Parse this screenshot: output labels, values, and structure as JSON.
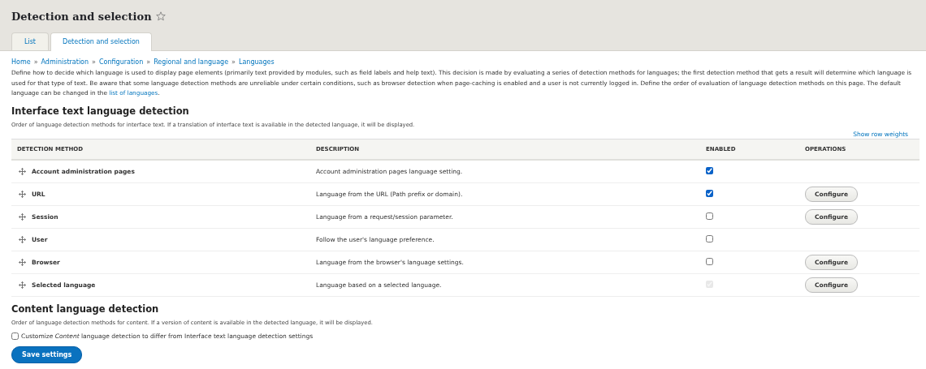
{
  "page_title": "Detection and selection",
  "favorite": {
    "starred": false
  },
  "tabs": [
    {
      "label": "List",
      "selected": false
    },
    {
      "label": "Detection and selection",
      "selected": true
    }
  ],
  "breadcrumb": [
    "Home",
    "Administration",
    "Configuration",
    "Regional and language",
    "Languages"
  ],
  "breadcrumb_separator": "»",
  "intro": {
    "text": "Define how to decide which language is used to display page elements (primarily text provided by modules, such as field labels and help text). This decision is made by evaluating a series of detection methods for languages; the first detection method that gets a result will determine which language is used for that type of text. Be aware that some language detection methods are unreliable under certain conditions, such as browser detection when page-caching is enabled and a user is not currently logged in. Define the order of evaluation of language detection methods on this page. The default language can be changed in the ",
    "link": "list of languages",
    "end": "."
  },
  "interface_section": {
    "heading": "Interface text language detection",
    "description": "Order of language detection methods for interface text. If a translation of interface text is available in the detected language, it will be displayed.",
    "row_weights_link": "Show row weights",
    "table": {
      "columns": [
        "DETECTION METHOD",
        "DESCRIPTION",
        "ENABLED",
        "OPERATIONS"
      ],
      "rows": [
        {
          "method": "Account administration pages",
          "description": "Account administration pages language setting.",
          "checked": true,
          "disabled": false
        },
        {
          "method": "URL",
          "description": "Language from the URL (Path prefix or domain).",
          "checked": true,
          "disabled": false,
          "operation": "Configure"
        },
        {
          "method": "Session",
          "description": "Language from a request/session parameter.",
          "checked": false,
          "disabled": false,
          "operation": "Configure"
        },
        {
          "method": "User",
          "description": "Follow the user's language preference.",
          "checked": false,
          "disabled": false
        },
        {
          "method": "Browser",
          "description": "Language from the browser's language settings.",
          "checked": false,
          "disabled": false,
          "operation": "Configure"
        },
        {
          "method": "Selected language",
          "description": "Language based on a selected language.",
          "checked": true,
          "disabled": true,
          "operation": "Configure"
        }
      ]
    }
  },
  "content_section": {
    "heading": "Content language detection",
    "description": "Order of language detection methods for content. If a version of content is available in the detected language, it will be displayed.",
    "customize": {
      "label": "Customize *Content* language detection to differ from Interface text language detection settings",
      "checked": false
    }
  },
  "save_button": "Save settings"
}
